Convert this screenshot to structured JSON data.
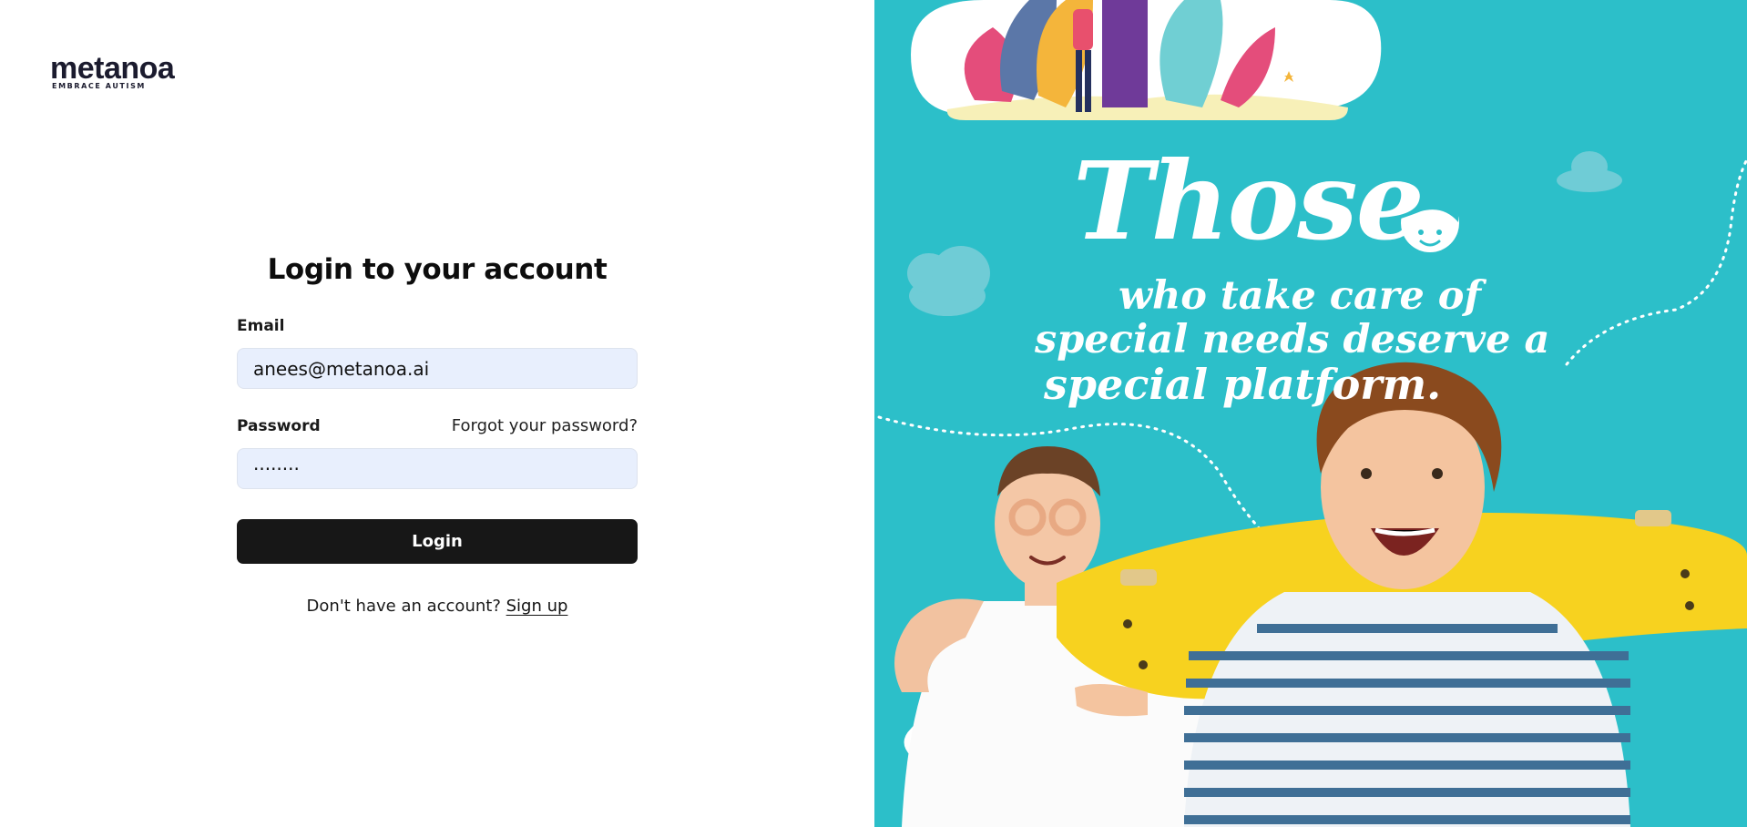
{
  "brand": {
    "name": "metanoa",
    "tagline": "EMBRACE AUTISM"
  },
  "login": {
    "title": "Login to your account",
    "email_label": "Email",
    "email_value": "anees@metanoa.ai",
    "password_label": "Password",
    "forgot_link": "Forgot your password?",
    "password_value": "········",
    "submit_label": "Login",
    "no_account_text": "Don't have an account?",
    "signup_link": "Sign up"
  },
  "hero": {
    "slogan_word": "Those",
    "slogan_line_1": "who take care of",
    "slogan_line_2": "special needs deserve a",
    "slogan_line_3": "special platform.",
    "background_color": "#2cbfc9"
  },
  "colors": {
    "button": "#171717",
    "input_fill": "#e8effd",
    "logo_accent_purple": "#7a3ea0",
    "logo_accent_orange": "#f3a33a"
  }
}
